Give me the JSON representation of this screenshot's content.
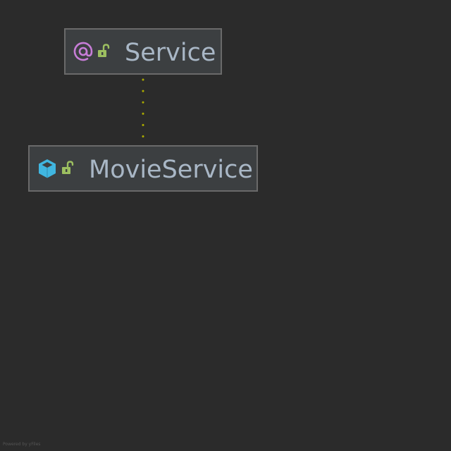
{
  "diagram": {
    "nodes": [
      {
        "id": "service",
        "label": "Service",
        "kind_icon": "annotation-at-icon",
        "visibility_icon": "open-lock-icon"
      },
      {
        "id": "movie-service",
        "label": "MovieService",
        "kind_icon": "class-cube-icon",
        "visibility_icon": "open-lock-icon"
      }
    ],
    "edges": [
      {
        "from": "movie-service",
        "to": "service",
        "style": "dotted",
        "color": "#a8a800"
      }
    ]
  },
  "footer": {
    "text": "Powered by yFiles"
  },
  "colors": {
    "background": "#2b2b2b",
    "node_fill": "#3c3f41",
    "node_border": "#6a6a6a",
    "label": "#a9b7c6",
    "annotation_icon": "#c77dd7",
    "class_icon": "#40b6e0",
    "lock_icon": "#9cbf60",
    "edge": "#a8a800"
  }
}
